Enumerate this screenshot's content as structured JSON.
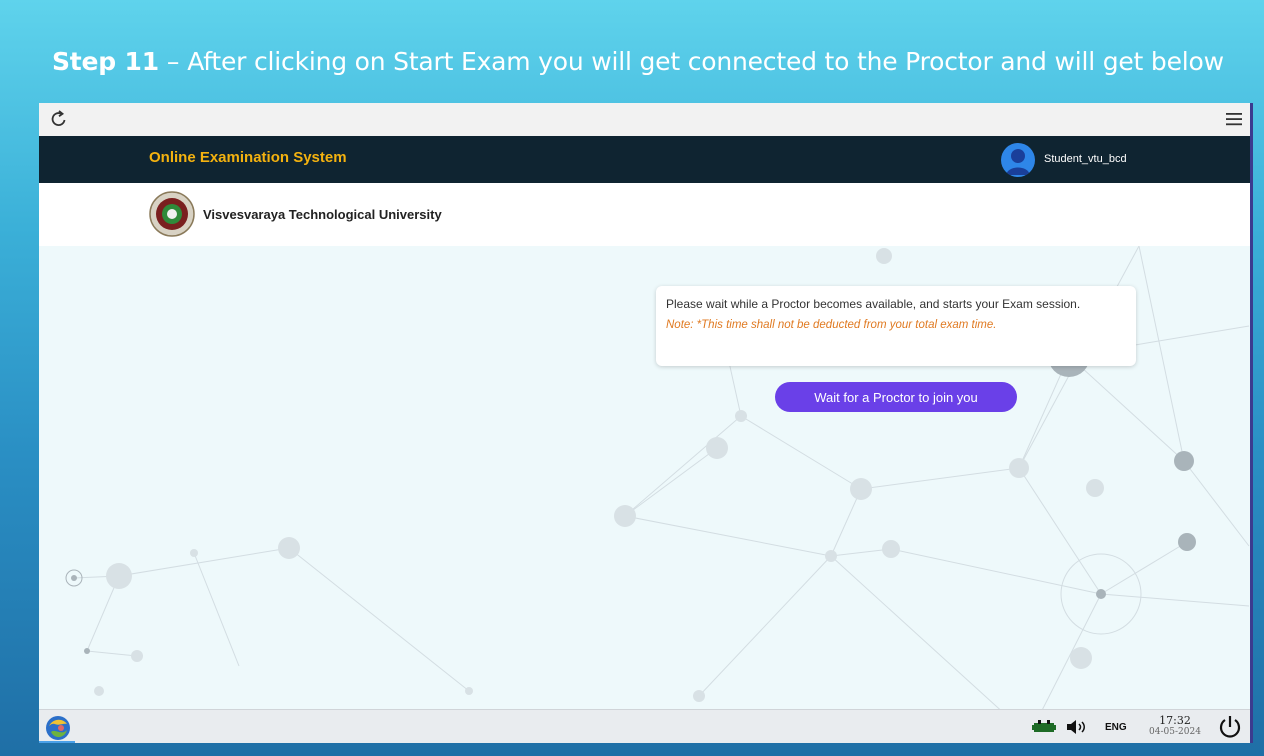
{
  "slide": {
    "step": "Step 11",
    "separator": "–",
    "text": "After clicking on Start Exam you will get connected to the Proctor and will get below"
  },
  "browser": {
    "reload_icon": "reload-icon",
    "menu_icon": "hamburger-menu-icon"
  },
  "header": {
    "title": "Online Examination System",
    "user_name": "Student_vtu_bcd",
    "avatar_icon": "user-avatar-icon",
    "title_color": "#f4b20f",
    "bg_color": "#0f2431"
  },
  "university": {
    "name": "Visvesvaraya Technological University",
    "logo_icon": "university-seal-icon"
  },
  "message": {
    "text": "Please wait while a Proctor becomes available, and starts your Exam session.",
    "note": "Note: *This time shall not be deducted from your total exam time.",
    "note_color": "#e07a22"
  },
  "proctor_button": {
    "label": "Wait for a Proctor to join you",
    "color": "#6a40e8"
  },
  "taskbar": {
    "start_icon": "start-menu-icon",
    "network_icon": "network-icon",
    "volume_icon": "volume-icon",
    "language": "ENG",
    "time": "17:32",
    "date": "04-05-2024",
    "power_icon": "power-icon"
  }
}
